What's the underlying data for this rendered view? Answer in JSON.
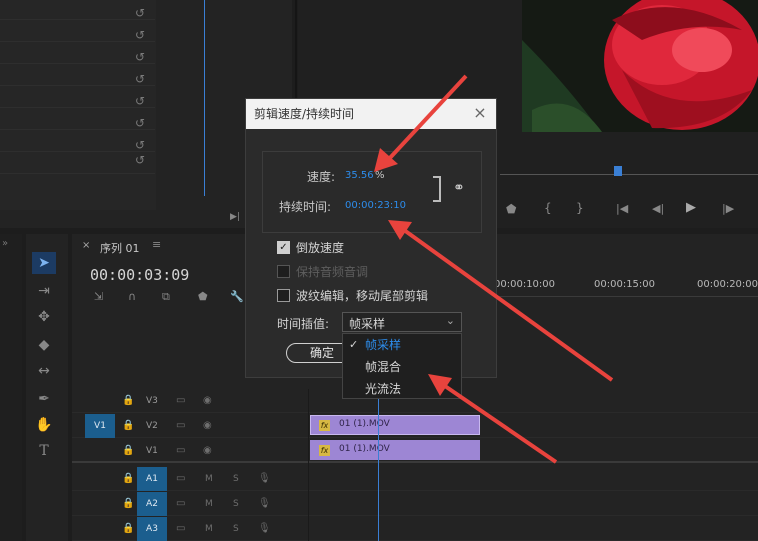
{
  "dialog": {
    "title": "剪辑速度/持续时间",
    "speed_label": "速度:",
    "speed_value": "35.56",
    "speed_unit": "%",
    "duration_label": "持续时间:",
    "duration_value": "00:00:23:10",
    "reverse_label": "倒放速度",
    "keep_audio_label": "保持音频音调",
    "ripple_label": "波纹编辑，移动尾部剪辑",
    "interp_label": "时间插值:",
    "interp_value": "帧采样",
    "ok_label": "确定",
    "reverse_checked": true,
    "keep_audio_enabled": false,
    "ripple_checked": false
  },
  "interp_menu": {
    "options": [
      "帧采样",
      "帧混合",
      "光流法"
    ],
    "selected": "帧采样"
  },
  "sequence": {
    "tab_name": "序列 01",
    "timecode": "00:00:03:09",
    "ruler": [
      "00:00:10:00",
      "00:00:15:00",
      "00:00:20:00"
    ]
  },
  "tracks": {
    "video": [
      "V3",
      "V2",
      "V1"
    ],
    "audio": [
      "A1",
      "A2",
      "A3"
    ],
    "source_patch": "V1",
    "mute_label": "M",
    "solo_label": "S"
  },
  "clips": [
    {
      "name": "01 (1).MOV",
      "badge": "fx"
    },
    {
      "name": "01 (1).MOV",
      "badge": "fx"
    }
  ],
  "colors": {
    "accent": "#2d8ceb",
    "clip": "#9d86d4",
    "arrow": "#e8433d",
    "track_target": "#1b5e8e"
  }
}
